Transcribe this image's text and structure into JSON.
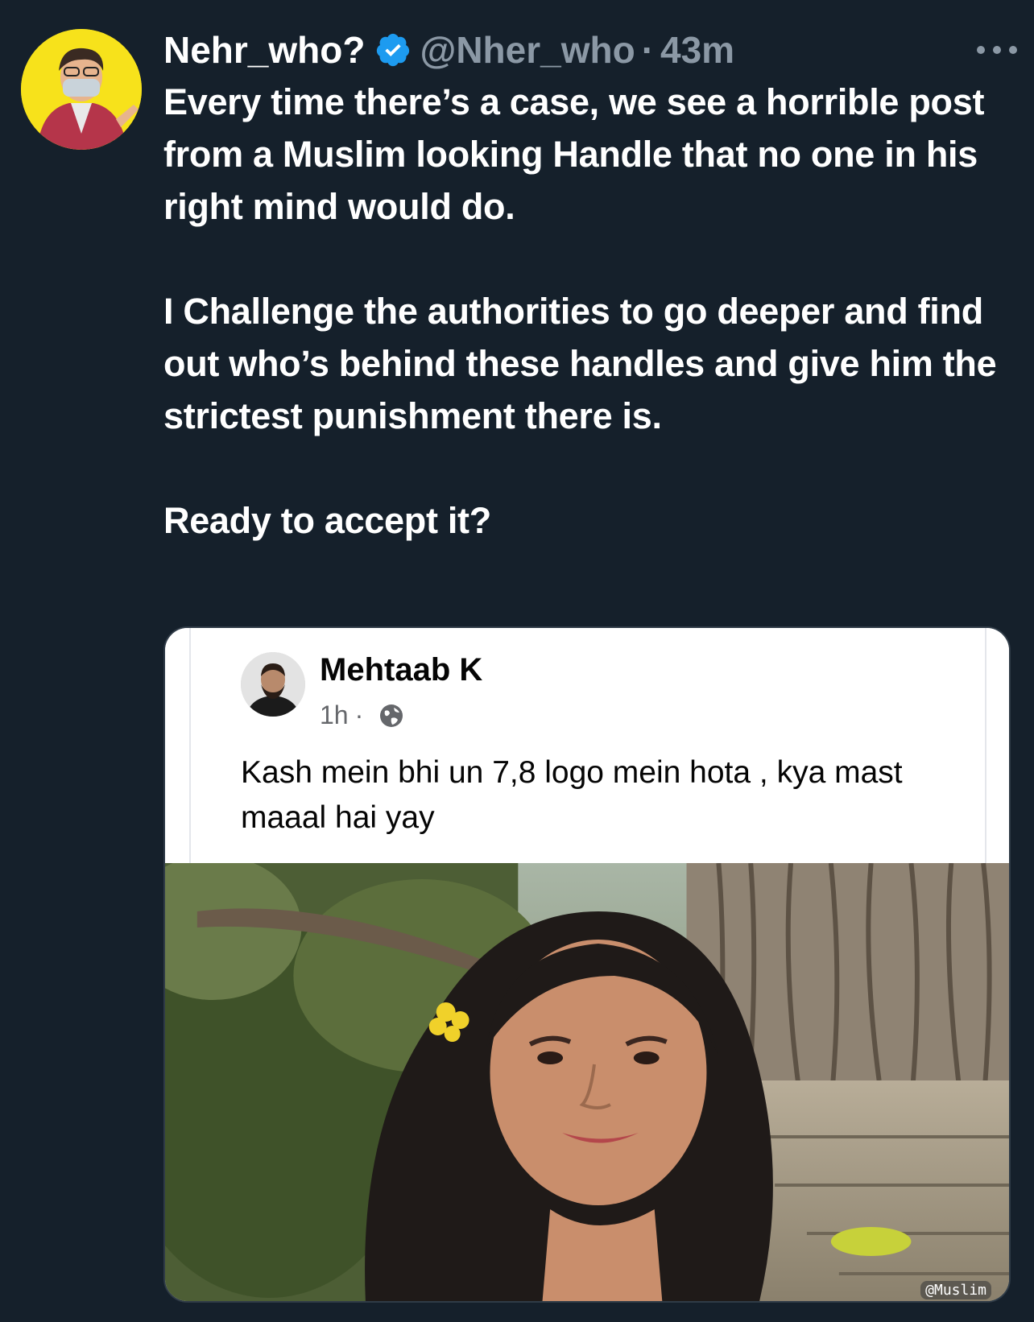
{
  "tweet": {
    "display_name": "Nehr_who?",
    "handle": "@Nher_who",
    "separator": "·",
    "time": "43m",
    "paragraphs": [
      "Every time there’s a case, we see a horrible post from a Muslim looking Handle that no one in his right mind would do.",
      "I Challenge the authorities to go deeper and find out who’s behind these handles and give him the strictest punishment there is.",
      "Ready to accept it?"
    ]
  },
  "embedded_post": {
    "author": "Mehtaab K",
    "time": "1h",
    "separator": "·",
    "text": "Kash mein bhi un 7,8 logo mein hota , kya mast maaal hai yay",
    "watermark": "@Muslim"
  },
  "colors": {
    "background": "#15202b",
    "verified": "#1d9bf0",
    "muted": "#8b98a5"
  },
  "icons": {
    "verified": "verified-badge-icon",
    "more": "more-options-icon",
    "globe": "globe-icon"
  }
}
